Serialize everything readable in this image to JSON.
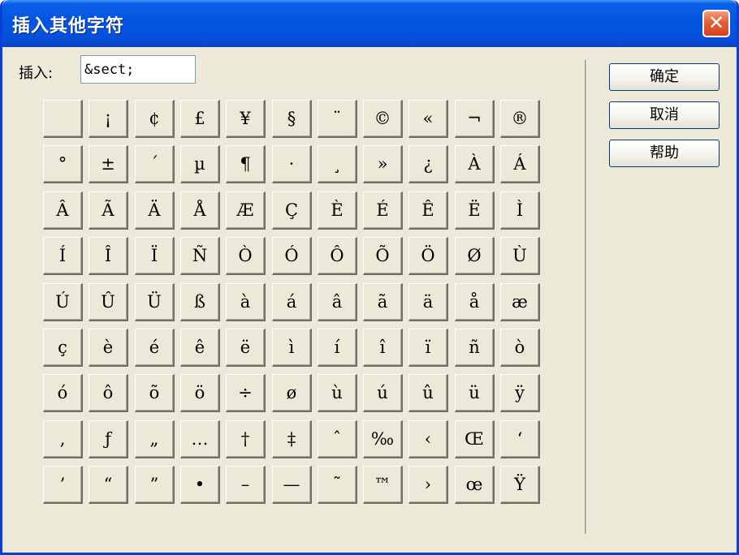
{
  "window": {
    "title": "插入其他字符",
    "close_glyph": "✕"
  },
  "insert": {
    "label": "插入:",
    "value": "&sect;"
  },
  "characters": [
    [
      "",
      "¡",
      "¢",
      "£",
      "¥",
      "§",
      "¨",
      "©",
      "«",
      "¬",
      "®"
    ],
    [
      "°",
      "±",
      "´",
      "µ",
      "¶",
      "·",
      "¸",
      "»",
      "¿",
      "À",
      "Á"
    ],
    [
      "Â",
      "Ã",
      "Ä",
      "Å",
      "Æ",
      "Ç",
      "È",
      "É",
      "Ê",
      "Ë",
      "Ì"
    ],
    [
      "Í",
      "Î",
      "Ï",
      "Ñ",
      "Ò",
      "Ó",
      "Ô",
      "Õ",
      "Ö",
      "Ø",
      "Ù"
    ],
    [
      "Ú",
      "Û",
      "Ü",
      "ß",
      "à",
      "á",
      "â",
      "ã",
      "ä",
      "å",
      "æ"
    ],
    [
      "ç",
      "è",
      "é",
      "ê",
      "ë",
      "ì",
      "í",
      "î",
      "ï",
      "ñ",
      "ò"
    ],
    [
      "ó",
      "ô",
      "õ",
      "ö",
      "÷",
      "ø",
      "ù",
      "ú",
      "û",
      "ü",
      "ÿ"
    ],
    [
      "‚",
      "ƒ",
      "„",
      "…",
      "†",
      "‡",
      "ˆ",
      "‰",
      "‹",
      "Œ",
      "‘"
    ],
    [
      "’",
      "“",
      "”",
      "•",
      "–",
      "—",
      "˜",
      "™",
      "›",
      "œ",
      "Ÿ"
    ]
  ],
  "buttons": {
    "ok": "确定",
    "cancel": "取消",
    "help": "帮助"
  },
  "colors": {
    "titlebar": "#0353dd",
    "dialog_bg": "#ece9d8",
    "close_button": "#d2431c"
  }
}
